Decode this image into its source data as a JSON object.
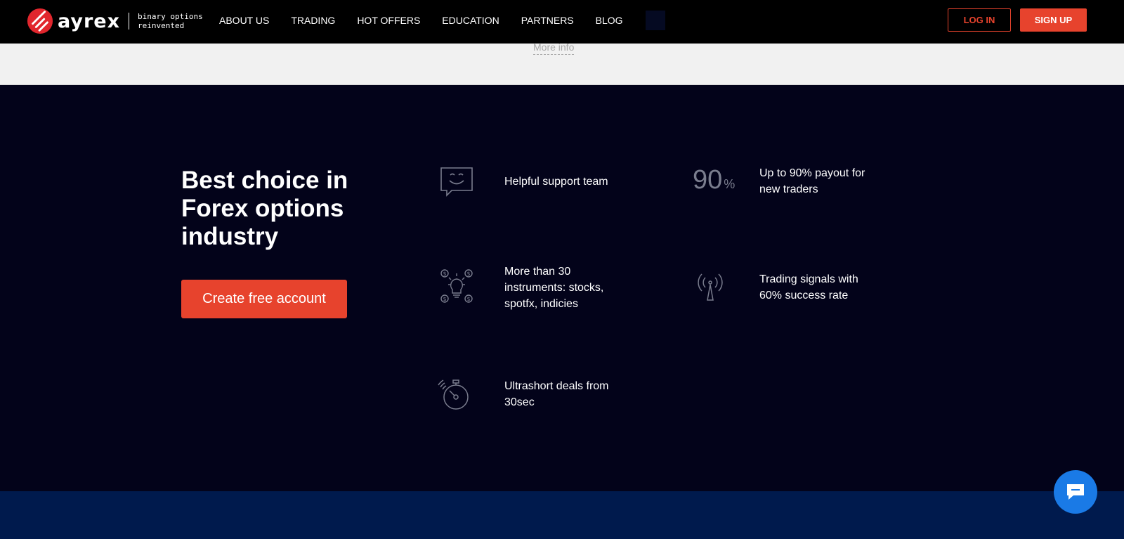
{
  "header": {
    "logo": {
      "wordmark": "ayrex",
      "tagline_line1": "binary options",
      "tagline_line2": "reinvented"
    },
    "nav": [
      {
        "label": "ABOUT US"
      },
      {
        "label": "TRADING"
      },
      {
        "label": "HOT OFFERS"
      },
      {
        "label": "EDUCATION"
      },
      {
        "label": "PARTNERS"
      },
      {
        "label": "BLOG"
      }
    ],
    "login_label": "LOG IN",
    "signup_label": "SIGN UP"
  },
  "strip": {
    "more_info": "More info"
  },
  "main": {
    "headline": "Best choice in Forex options industry",
    "cta_label": "Create free account",
    "features": [
      {
        "icon": "smile-chat-icon",
        "text": "Helpful support team"
      },
      {
        "icon": "percent-90-icon",
        "big": "90",
        "small": "%",
        "text": "Up to 90% payout for\nnew traders"
      },
      {
        "icon": "lightbulb-dollar-icon",
        "text": "More than 30\ninstruments: stocks,\nspotfx, indicies"
      },
      {
        "icon": "signal-antenna-icon",
        "text": "Trading signals with\n60% success rate"
      },
      {
        "icon": "stopwatch-icon",
        "text": "Ultrashort deals from\n30sec"
      }
    ]
  },
  "colors": {
    "accent": "#e7432d",
    "dark_bg": "#03031a",
    "band_bg": "#001a4d",
    "chat": "#1a7ae6"
  }
}
